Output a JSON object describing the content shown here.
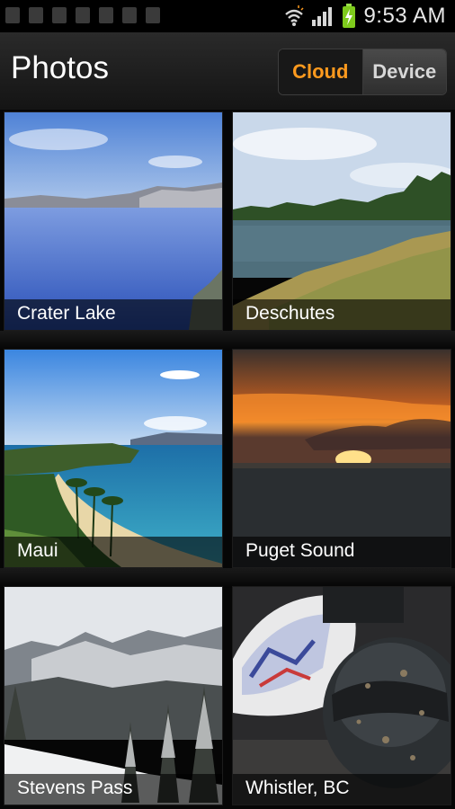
{
  "status_bar": {
    "time": "9:53 AM",
    "icons": [
      "wifi-icon",
      "signal-icon",
      "battery-charging-icon"
    ],
    "notification_icons": [
      "notification-icon",
      "notification-icon",
      "notification-icon",
      "notification-icon",
      "notification-icon",
      "notification-icon",
      "notification-icon"
    ]
  },
  "action_bar": {
    "title": "Photos",
    "toggle": {
      "options": [
        "Cloud",
        "Device"
      ],
      "selected": "Cloud"
    }
  },
  "photos": [
    {
      "label": "Crater Lake"
    },
    {
      "label": "Deschutes"
    },
    {
      "label": "Maui"
    },
    {
      "label": "Puget Sound"
    },
    {
      "label": "Stevens Pass"
    },
    {
      "label": "Whistler, BC"
    }
  ],
  "colors": {
    "accent": "#ff9a1e",
    "background": "#0a0a0a"
  }
}
